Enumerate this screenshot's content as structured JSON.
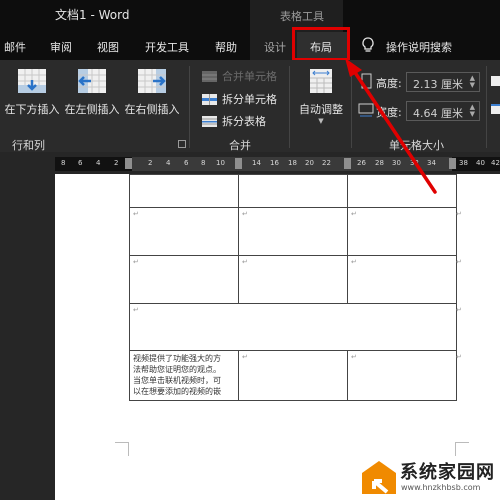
{
  "window": {
    "title": "文档1  -  Word"
  },
  "context_tab_group": "表格工具",
  "tabs": [
    {
      "label": "邮件",
      "active": false
    },
    {
      "label": "审阅",
      "active": false
    },
    {
      "label": "视图",
      "active": false
    },
    {
      "label": "开发工具",
      "active": false
    },
    {
      "label": "帮助",
      "active": false
    },
    {
      "label": "设计",
      "active": false
    },
    {
      "label": "布局",
      "active": true
    }
  ],
  "tell_me": {
    "icon": "lightbulb-icon",
    "label": "操作说明搜索"
  },
  "ribbon": {
    "rows_cols": {
      "label": "行和列",
      "buttons": [
        {
          "label": "在下方插入",
          "icon": "insert-below-icon"
        },
        {
          "label": "在左侧插入",
          "icon": "insert-left-icon"
        },
        {
          "label": "在右侧插入",
          "icon": "insert-right-icon"
        }
      ]
    },
    "merge": {
      "label": "合并",
      "buttons": [
        {
          "label": "合并单元格",
          "icon": "merge-cells-icon",
          "enabled": false
        },
        {
          "label": "拆分单元格",
          "icon": "split-cells-icon",
          "enabled": true
        },
        {
          "label": "拆分表格",
          "icon": "split-table-icon",
          "enabled": true
        }
      ]
    },
    "autofit": {
      "label": "自动调整",
      "icon": "autofit-icon"
    },
    "cell_size": {
      "label": "单元格大小",
      "height_label": "高度:",
      "height_value": "2.13 厘米",
      "width_label": "宽度:",
      "width_value": "4.64 厘米"
    }
  },
  "ruler": {
    "left_numbers": [
      "8",
      "6",
      "4",
      "2"
    ],
    "right_numbers": [
      "2",
      "4",
      "6",
      "8",
      "10",
      "14",
      "16",
      "18",
      "20",
      "22",
      "2",
      "26",
      "28",
      "30",
      "32",
      "34",
      "36",
      "38",
      "40",
      "42"
    ]
  },
  "document": {
    "cell_text": "视频提供了功能强大的方法帮助您证明您的观点。当您单击联机视频时，可以在想要添加的视频的嵌",
    "cell_text_lines": [
      "视频提供了功能强大的方",
      "法帮助您证明您的观点。",
      "当您单击联机视频时，可",
      "以在想要添加的视频的嵌"
    ],
    "paragraph_mark": "↵"
  },
  "annotation": {
    "highlight_color": "#e00000"
  },
  "watermark": {
    "title": "系统家园网",
    "url": "www.hnzkhbsb.com",
    "color": "#f08a00"
  }
}
